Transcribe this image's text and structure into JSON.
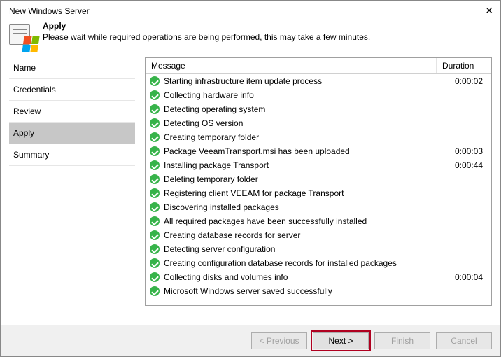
{
  "window": {
    "title": "New Windows Server",
    "close": "✕"
  },
  "header": {
    "heading": "Apply",
    "sub": "Please wait while required operations are being performed, this may take a few minutes."
  },
  "sidebar": {
    "items": [
      {
        "label": "Name"
      },
      {
        "label": "Credentials"
      },
      {
        "label": "Review"
      },
      {
        "label": "Apply"
      },
      {
        "label": "Summary"
      }
    ],
    "activeIndex": 3
  },
  "grid": {
    "headers": {
      "message": "Message",
      "duration": "Duration"
    },
    "rows": [
      {
        "msg": "Starting infrastructure item update process",
        "dur": "0:00:02"
      },
      {
        "msg": "Collecting hardware info",
        "dur": ""
      },
      {
        "msg": "Detecting operating system",
        "dur": ""
      },
      {
        "msg": "Detecting OS version",
        "dur": ""
      },
      {
        "msg": "Creating temporary folder",
        "dur": ""
      },
      {
        "msg": "Package VeeamTransport.msi has been uploaded",
        "dur": "0:00:03"
      },
      {
        "msg": "Installing package Transport",
        "dur": "0:00:44"
      },
      {
        "msg": "Deleting temporary folder",
        "dur": ""
      },
      {
        "msg": "Registering client VEEAM for package Transport",
        "dur": ""
      },
      {
        "msg": "Discovering installed packages",
        "dur": ""
      },
      {
        "msg": "All required packages have been successfully installed",
        "dur": ""
      },
      {
        "msg": "Creating database records for server",
        "dur": ""
      },
      {
        "msg": "Detecting server configuration",
        "dur": ""
      },
      {
        "msg": "Creating configuration database records for installed packages",
        "dur": ""
      },
      {
        "msg": "Collecting disks and volumes info",
        "dur": "0:00:04"
      },
      {
        "msg": "Microsoft Windows server saved successfully",
        "dur": ""
      }
    ]
  },
  "footer": {
    "previous": "< Previous",
    "next": "Next >",
    "finish": "Finish",
    "cancel": "Cancel"
  }
}
